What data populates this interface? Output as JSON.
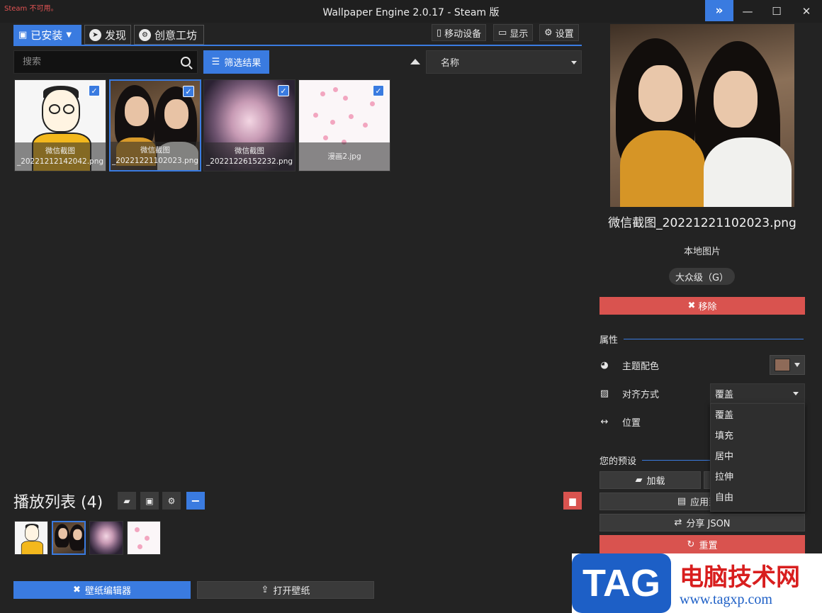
{
  "window": {
    "steam_warning": "Steam 不可用。",
    "title": "Wallpaper Engine 2.0.17 - Steam 版",
    "expand_icon": "double-chevron-right-icon",
    "minimize": "—",
    "maximize": "☐",
    "close": "✕"
  },
  "tabs": [
    {
      "label": "已安装",
      "icon": "save-icon",
      "active": true
    },
    {
      "label": "发现",
      "icon": "compass-icon",
      "active": false
    },
    {
      "label": "创意工坊",
      "icon": "steam-icon",
      "active": false
    }
  ],
  "top_buttons": {
    "mobile": "移动设备",
    "display": "显示",
    "settings": "设置"
  },
  "search": {
    "placeholder": "搜索",
    "value": ""
  },
  "filter_label": "筛选结果",
  "sort": {
    "selected": "名称"
  },
  "wallpapers": [
    {
      "line1": "微信截图",
      "line2": "_20221212142042.png",
      "checked": true,
      "selected": false
    },
    {
      "line1": "微信截图",
      "line2": "_20221221102023.png",
      "checked": true,
      "selected": true
    },
    {
      "line1": "微信截图",
      "line2": "_20221226152232.png",
      "checked": true,
      "selected": false
    },
    {
      "line1": "漫画2.jpg",
      "line2": "",
      "checked": true,
      "selected": false
    }
  ],
  "playlist": {
    "title": "播放列表 (4)"
  },
  "bottom_buttons": {
    "editor": "壁纸编辑器",
    "open": "打开壁纸"
  },
  "details": {
    "title": "微信截图_20221221102023.png",
    "type": "本地图片",
    "rating": "大众级（G）",
    "remove_label": "移除"
  },
  "properties": {
    "heading": "属性",
    "theme_color_label": "主题配色",
    "theme_color": "#8e6a58",
    "align_label": "对齐方式",
    "align_selected": "覆盖",
    "position_label": "位置",
    "align_options": [
      "覆盖",
      "填充",
      "居中",
      "拉伸",
      "自由"
    ]
  },
  "presets": {
    "heading": "您的预设",
    "load": "加载",
    "apply": "应用到所",
    "share": "分享 JSON",
    "reset": "重置"
  },
  "watermark": {
    "tag": "TAG",
    "cn": "电脑技术网",
    "url": "www.tagxp.com"
  },
  "colors": {
    "accent": "#3a7be0",
    "danger": "#d9534f",
    "bg": "#232323"
  }
}
